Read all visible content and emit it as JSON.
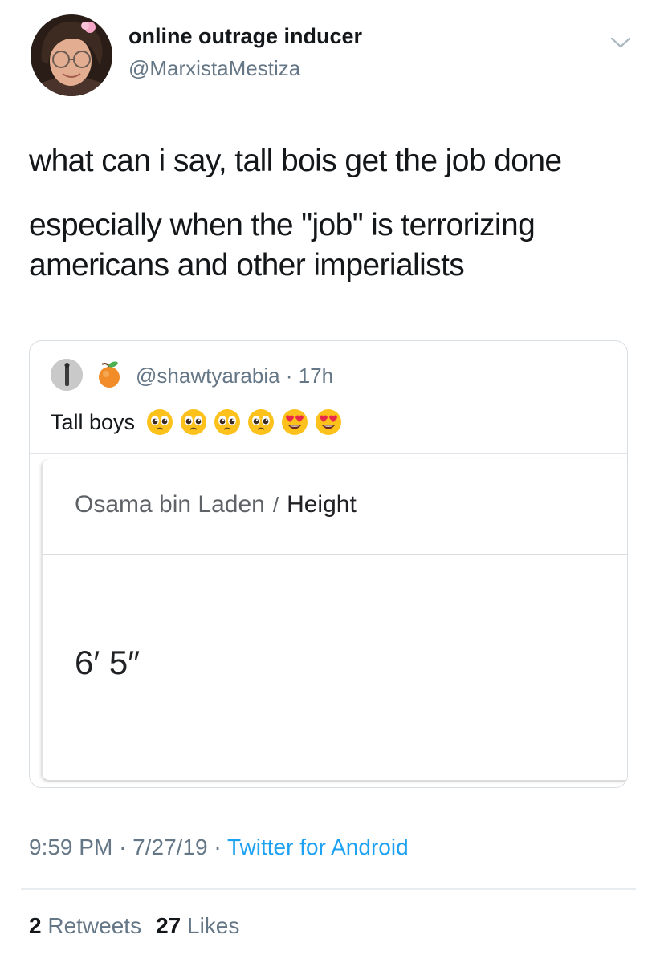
{
  "author": {
    "display_name": "online outrage inducer",
    "handle": "@MarxistaMestiza",
    "avatar_icon": "profile-photo"
  },
  "tweet": {
    "lines": [
      "what can i say, tall bois get the job done",
      "especially when the \"job\" is terrorizing americans and other imperialists"
    ]
  },
  "quoted_tweet": {
    "handle_and_time": "@shawtyarabia · 17h",
    "name_icon": "peach-emoji",
    "text": "Tall boys",
    "emojis": [
      "pleading-face-emoji",
      "pleading-face-emoji",
      "pleading-face-emoji",
      "pleading-face-emoji",
      "heart-eyes-emoji",
      "heart-eyes-emoji"
    ],
    "image": {
      "entity": "Osama bin Laden",
      "separator": "/",
      "attribute": "Height",
      "value": "6′ 5″"
    }
  },
  "footer": {
    "time": "9:59 PM",
    "date": "7/27/19",
    "dot": "·",
    "source": "Twitter for Android"
  },
  "stats": {
    "retweets_count": "2",
    "retweets_label": "Retweets",
    "likes_count": "27",
    "likes_label": "Likes"
  },
  "colors": {
    "text": "#14171a",
    "secondary": "#657786",
    "link": "#1da1f2",
    "border": "#d9dee3"
  }
}
